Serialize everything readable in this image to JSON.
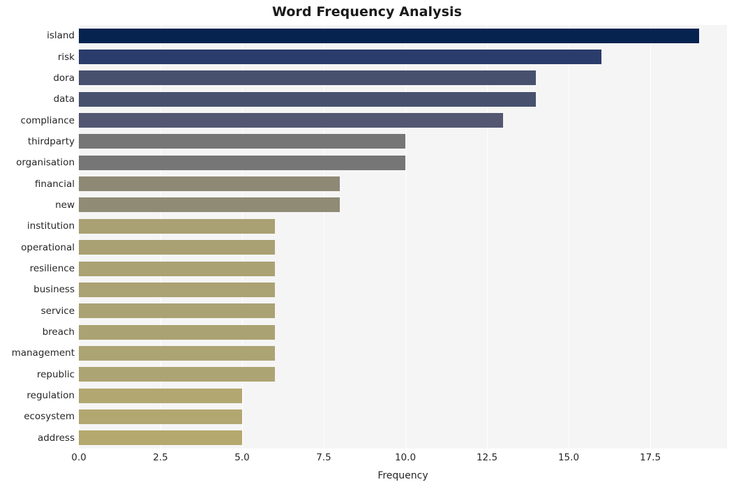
{
  "chart_data": {
    "type": "bar",
    "orientation": "horizontal",
    "title": "Word Frequency Analysis",
    "xlabel": "Frequency",
    "ylabel": "",
    "categories": [
      "island",
      "risk",
      "dora",
      "data",
      "compliance",
      "thirdparty",
      "organisation",
      "financial",
      "new",
      "institution",
      "operational",
      "resilience",
      "business",
      "service",
      "breach",
      "management",
      "republic",
      "regulation",
      "ecosystem",
      "address"
    ],
    "values": [
      19,
      16,
      14,
      14,
      13,
      10,
      10,
      8,
      8,
      6,
      6,
      6,
      6,
      6,
      6,
      6,
      6,
      5,
      5,
      5
    ],
    "bar_colors": [
      "#062350",
      "#2a3c6b",
      "#47516e",
      "#47516e",
      "#545772",
      "#767676",
      "#767676",
      "#8d8974",
      "#8f8b75",
      "#a9a073",
      "#a9a073",
      "#aba273",
      "#aba273",
      "#aba273",
      "#aba273",
      "#ada473",
      "#ada473",
      "#b2a771",
      "#b2a771",
      "#b5a86e"
    ],
    "xticks": [
      0.0,
      2.5,
      5.0,
      7.5,
      10.0,
      12.5,
      15.0,
      17.5
    ],
    "xtick_labels": [
      "0.0",
      "2.5",
      "5.0",
      "7.5",
      "10.0",
      "12.5",
      "15.0",
      "17.5"
    ],
    "xlim": [
      0,
      19.85
    ],
    "grid": "vertical",
    "grid_color": "#ffffff",
    "plot_background": "#f5f5f5",
    "figure_background": "#ffffff",
    "legend": "none"
  }
}
